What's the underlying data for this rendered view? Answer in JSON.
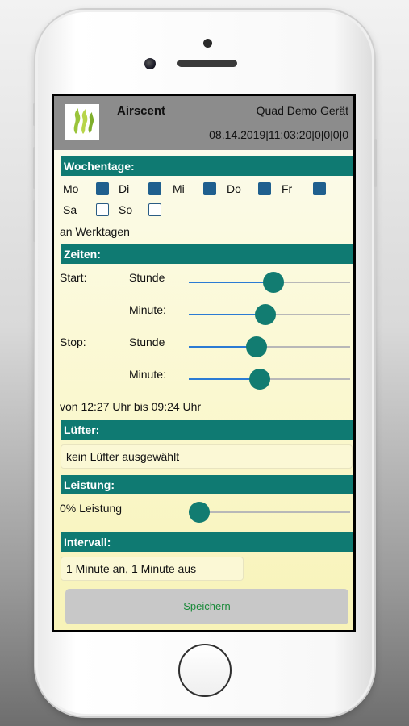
{
  "header": {
    "app_name": "Airscent",
    "device_name": "Quad Demo Gerät",
    "timestamp": "08.14.2019|11:03:20|0|0|0|0"
  },
  "weekdays": {
    "title": "Wochentage:",
    "days": [
      {
        "label": "Mo",
        "checked": true
      },
      {
        "label": "Di",
        "checked": true
      },
      {
        "label": "Mi",
        "checked": true
      },
      {
        "label": "Do",
        "checked": true
      },
      {
        "label": "Fr",
        "checked": true
      },
      {
        "label": "Sa",
        "checked": false
      },
      {
        "label": "So",
        "checked": false
      }
    ],
    "summary": "an Werktagen"
  },
  "times": {
    "title": "Zeiten:",
    "start_label": "Start:",
    "stop_label": "Stop:",
    "hour_label": "Stunde",
    "minute_label": "Minute:",
    "sliders": {
      "start_hour": 0.53,
      "start_minute": 0.47,
      "stop_hour": 0.41,
      "stop_minute": 0.43
    },
    "summary": "von 12:27 Uhr bis 09:24 Uhr"
  },
  "fan": {
    "title": "Lüfter:",
    "value": "kein Lüfter ausgewählt"
  },
  "power": {
    "title": "Leistung:",
    "label": "0% Leistung",
    "slider": 0.0
  },
  "interval": {
    "title": "Intervall:",
    "value": "1 Minute an, 1 Minute aus"
  },
  "save_label": "Speichern",
  "colors": {
    "accent": "#0f7a72",
    "header_bg": "#8c8c8c",
    "checkbox": "#1f5f8e",
    "slider_fill": "#2b7bd4",
    "save_text": "#1a8a3a"
  }
}
